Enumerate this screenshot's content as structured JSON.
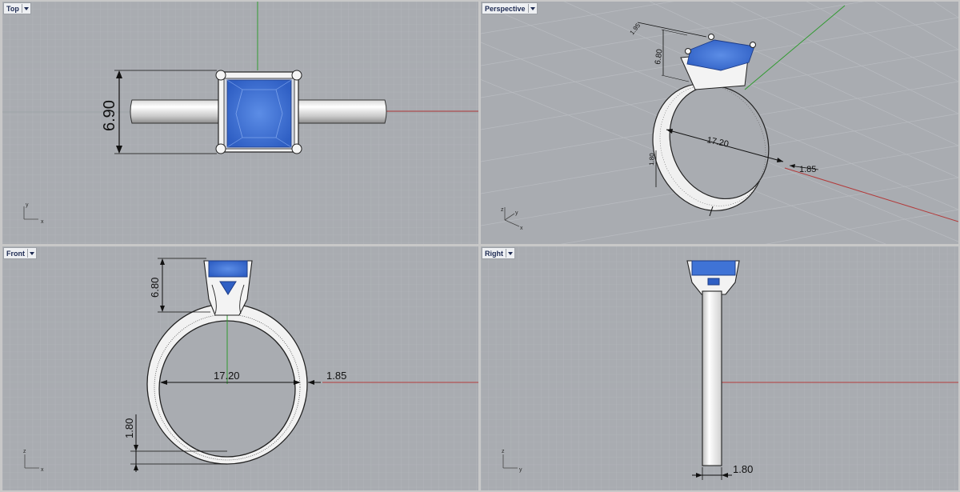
{
  "viewports": {
    "top": {
      "title": "Top",
      "dimension_height": "6.90",
      "axis_y": "y",
      "axis_x": "x"
    },
    "perspective": {
      "title": "Perspective",
      "dimension_small": "1.95",
      "dimension_height": "6.80",
      "dimension_diameter": "17.20",
      "dimension_band": "1.80",
      "dimension_width": "1.85",
      "axis_z": "z",
      "axis_y": "y",
      "axis_x": "x"
    },
    "front": {
      "title": "Front",
      "dimension_height": "6.80",
      "dimension_diameter": "17.20",
      "dimension_width": "1.85",
      "dimension_band": "1.80",
      "axis_z": "z",
      "axis_x": "x"
    },
    "right": {
      "title": "Right",
      "dimension_band": "1.80",
      "axis_z": "z",
      "axis_y": "y"
    }
  },
  "colors": {
    "viewport_bg": "#a9acb1",
    "grid_minor": "#b8bbc0",
    "grid_major": "#9da0a6",
    "axis_x": "#b33a3a",
    "axis_y": "#2f9a2f",
    "gem": "#3f73d6",
    "metal": "#f2f2f2"
  }
}
